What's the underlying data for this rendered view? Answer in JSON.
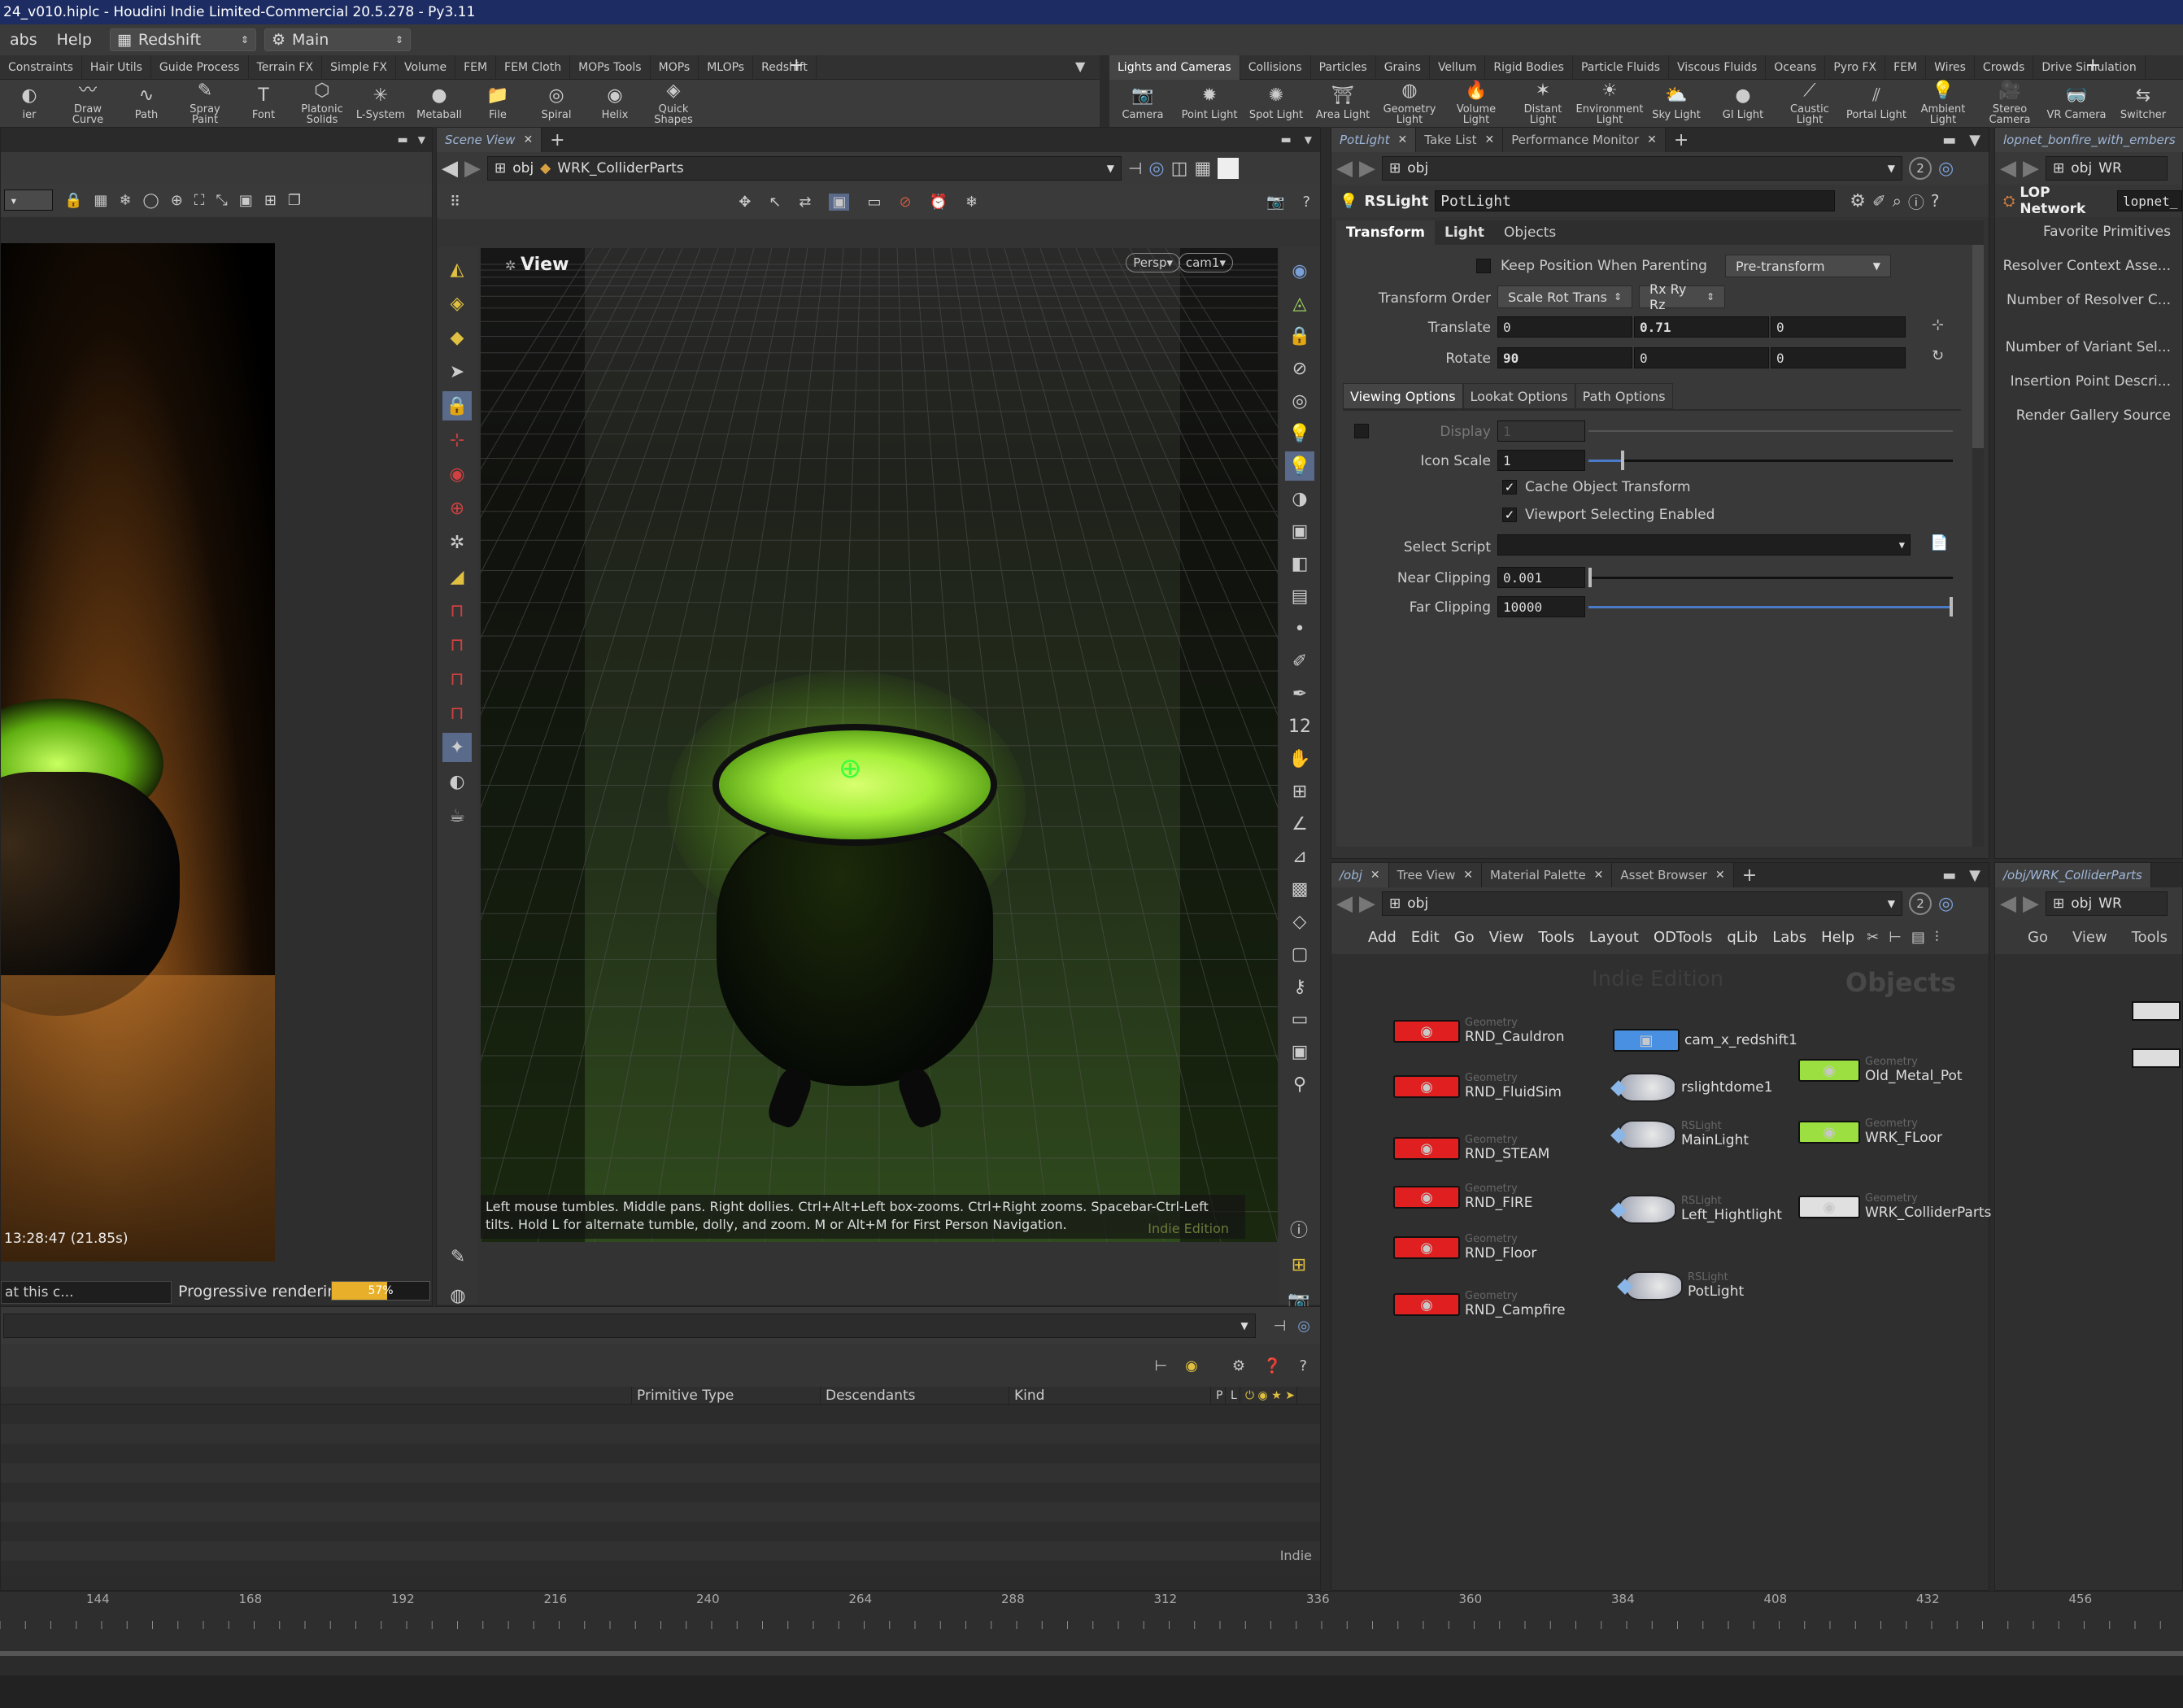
{
  "title": "24_v010.hiplc - Houdini Indie Limited-Commercial 20.5.278 - Py3.11",
  "menu": {
    "items": [
      "abs",
      "Help"
    ],
    "desktop_label": "Redshift",
    "context_label": "Main"
  },
  "shelf_left": {
    "tabs": [
      "Constraints",
      "Hair Utils",
      "Guide Process",
      "Terrain FX",
      "Simple FX",
      "Volume",
      "FEM",
      "FEM Cloth",
      "MOPs Tools",
      "MOPs",
      "MLOPs",
      "Redshift"
    ],
    "tools": [
      "ier",
      "Draw Curve",
      "Path",
      "Spray Paint",
      "Font",
      "Platonic Solids",
      "L-System",
      "Metaball",
      "File",
      "Spiral",
      "Helix",
      "Quick Shapes"
    ]
  },
  "shelf_right": {
    "tabs": [
      "Lights and Cameras",
      "Collisions",
      "Particles",
      "Grains",
      "Vellum",
      "Rigid Bodies",
      "Particle Fluids",
      "Viscous Fluids",
      "Oceans",
      "Pyro FX",
      "FEM",
      "Wires",
      "Crowds",
      "Drive Simulation"
    ],
    "tools": [
      "Camera",
      "Point Light",
      "Spot Light",
      "Area Light",
      "Geometry Light",
      "Volume Light",
      "Distant Light",
      "Environment Light",
      "Sky Light",
      "GI Light",
      "Caustic Light",
      "Portal Light",
      "Ambient Light",
      "Stereo Camera",
      "VR Camera",
      "Switcher"
    ]
  },
  "render_view": {
    "time_text": "13:28:47 (21.85s)",
    "status_left": "at this c...",
    "progress_label": "Progressive rendering",
    "progress_value": "57%",
    "progress_fraction": 0.57
  },
  "scene_view": {
    "tab": "Scene View",
    "path_root": "obj",
    "path_node": "WRK_ColliderParts",
    "view_label": "View",
    "persp_label": "Persp",
    "cam_label": "cam1",
    "hint": "Left mouse tumbles. Middle pans. Right dollies. Ctrl+Alt+Left box-zooms. Ctrl+Right zooms. Spacebar-Ctrl-Left tilts. Hold L for alternate tumble, dolly, and zoom. M or Alt+M for First Person Navigation.",
    "watermark": "Indie Edition"
  },
  "param_pane": {
    "tabs": [
      "PotLight",
      "Take List",
      "Performance Monitor"
    ],
    "path_root": "obj",
    "badge": "2",
    "node_type": "RSLight",
    "node_name": "PotLight",
    "sub_tabs": [
      "Transform",
      "Light",
      "Objects"
    ],
    "keep_position_label": "Keep Position When Parenting",
    "pre_transform_label": "Pre-transform",
    "transform_order_label": "Transform Order",
    "transform_order_value": "Scale Rot Trans",
    "rot_order_value": "Rx Ry Rz",
    "translate_label": "Translate",
    "translate": [
      "0",
      "0.71",
      "0"
    ],
    "rotate_label": "Rotate",
    "rotate": [
      "90",
      "0",
      "0"
    ],
    "folder_tabs": [
      "Viewing Options",
      "Lookat Options",
      "Path Options"
    ],
    "display_label": "Display",
    "display_value": "1",
    "icon_scale_label": "Icon Scale",
    "icon_scale_value": "1",
    "cache_label": "Cache Object Transform",
    "viewport_sel_label": "Viewport Selecting Enabled",
    "select_script_label": "Select Script",
    "near_label": "Near Clipping",
    "near_value": "0.001",
    "far_label": "Far Clipping",
    "far_value": "10000"
  },
  "lop_pane": {
    "tab": "lopnet_bonfire_with_embers",
    "path_root": "obj",
    "path_node": "WR",
    "node_type": "LOP Network",
    "node_name": "lopnet_",
    "items": [
      "Favorite Primitives",
      "Resolver Context Asse...",
      "Number of Resolver C...",
      "Number of Variant Sel...",
      "Insertion Point Descri...",
      "Render Gallery Source"
    ]
  },
  "network": {
    "tabs": [
      "/obj",
      "Tree View",
      "Material Palette",
      "Asset Browser"
    ],
    "path_root": "obj",
    "badge": "2",
    "menus": [
      "Add",
      "Edit",
      "Go",
      "View",
      "Tools",
      "Layout",
      "ODTools",
      "qLib",
      "Labs",
      "Help"
    ],
    "watermark": "Indie Edition",
    "context_title": "Objects",
    "geo_nodes": [
      {
        "type": "Geometry",
        "name": "RND_Cauldron"
      },
      {
        "type": "Geometry",
        "name": "RND_FluidSim"
      },
      {
        "type": "Geometry",
        "name": "RND_STEAM"
      },
      {
        "type": "Geometry",
        "name": "RND_FIRE"
      },
      {
        "type": "Geometry",
        "name": "RND_Floor"
      },
      {
        "type": "Geometry",
        "name": "RND_Campfire"
      }
    ],
    "cam_node": {
      "name": "cam_x_redshift1"
    },
    "light_nodes": [
      {
        "type": "",
        "name": "rslightdome1"
      },
      {
        "type": "RSLight",
        "name": "MainLight"
      },
      {
        "type": "RSLight",
        "name": "Left_Hightlight"
      },
      {
        "type": "RSLight",
        "name": "PotLight"
      }
    ],
    "right_nodes": [
      {
        "type": "Geometry",
        "name": "Old_Metal_Pot"
      },
      {
        "type": "Geometry",
        "name": "WRK_FLoor"
      },
      {
        "type": "Geometry",
        "name": "WRK_ColliderParts"
      }
    ]
  },
  "network2": {
    "tab": "/obj/WRK_ColliderParts",
    "path_root": "obj",
    "path_node": "WR",
    "menus": [
      "Go",
      "View",
      "Tools"
    ]
  },
  "scene_graph": {
    "columns": [
      "Primitive Type",
      "Descendants",
      "Kind",
      "P",
      "L"
    ],
    "watermark": "Indie"
  },
  "timeline": {
    "ticks": [
      "144",
      "168",
      "192",
      "216",
      "240",
      "264",
      "288",
      "312",
      "336",
      "360",
      "384",
      "408",
      "432",
      "456"
    ]
  },
  "colors": {
    "accent": "#1d2d63",
    "geo_node": "#e02020",
    "cam_node": "#4a90e2",
    "green_node": "#9be040",
    "progress": "#e8b02a"
  }
}
